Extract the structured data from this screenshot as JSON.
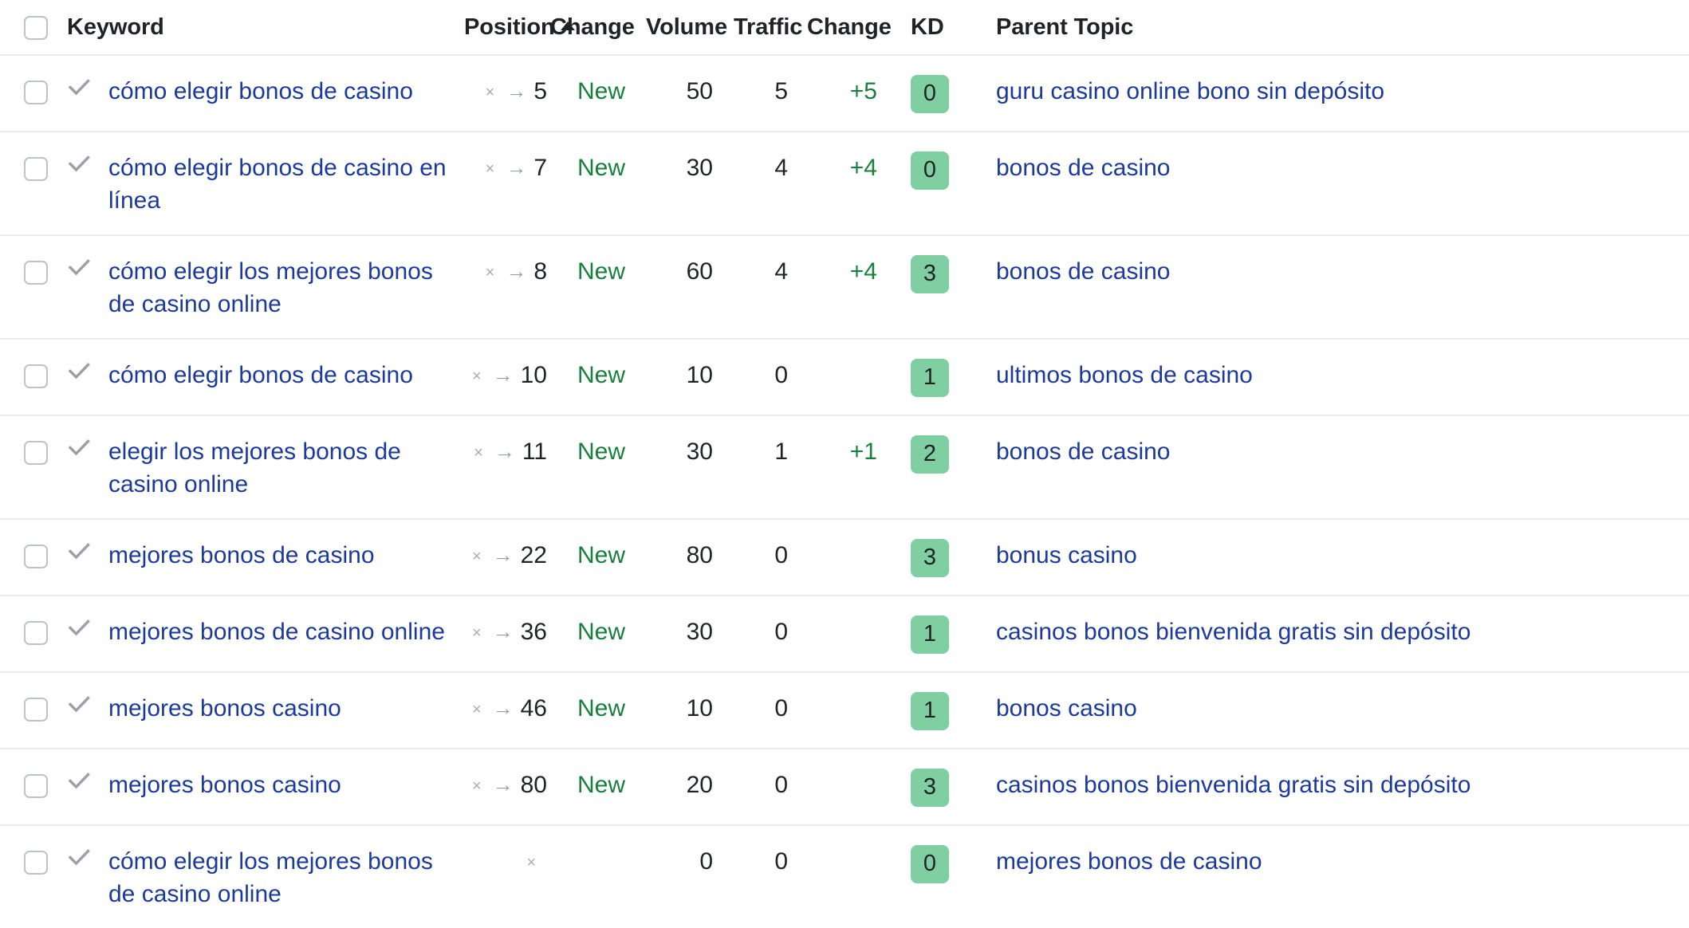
{
  "table": {
    "columns": [
      {
        "key": "checkbox",
        "label": ""
      },
      {
        "key": "keyword",
        "label": "Keyword"
      },
      {
        "key": "position",
        "label": "Position",
        "sorted": "asc"
      },
      {
        "key": "position_change",
        "label": "Change"
      },
      {
        "key": "volume",
        "label": "Volume"
      },
      {
        "key": "traffic",
        "label": "Traffic"
      },
      {
        "key": "traffic_change",
        "label": "Change"
      },
      {
        "key": "kd",
        "label": "KD"
      },
      {
        "key": "parent_topic",
        "label": "Parent Topic"
      }
    ],
    "icons": {
      "select_all": "checkbox-unchecked",
      "row_select": "checkbox-unchecked",
      "row_status": "check-icon",
      "position_remove": "close-icon",
      "position_trend": "arrow-right-icon",
      "sort": "caret-up-icon"
    },
    "colors": {
      "link": "#1b3a9c",
      "positive": "#16803c",
      "kd_badge_bg": "#7fcfa2",
      "muted": "#a9adb5",
      "row_divider": "#e9ebef"
    },
    "rows": [
      {
        "keyword": "cómo elegir bonos de casino",
        "x": "×",
        "arrow": "→",
        "position": "5",
        "position_change": "New",
        "volume": "50",
        "traffic": "5",
        "traffic_change": "+5",
        "kd": "0",
        "parent_topic": "guru casino online bono sin depósito"
      },
      {
        "keyword": "cómo elegir bonos de casino en línea",
        "x": "×",
        "arrow": "→",
        "position": "7",
        "position_change": "New",
        "volume": "30",
        "traffic": "4",
        "traffic_change": "+4",
        "kd": "0",
        "parent_topic": "bonos de casino"
      },
      {
        "keyword": "cómo elegir los mejores bonos de casino online",
        "x": "×",
        "arrow": "→",
        "position": "8",
        "position_change": "New",
        "volume": "60",
        "traffic": "4",
        "traffic_change": "+4",
        "kd": "3",
        "parent_topic": "bonos de casino"
      },
      {
        "keyword": "cómo elegir bonos de casino",
        "x": "×",
        "arrow": "→",
        "position": "10",
        "position_change": "New",
        "volume": "10",
        "traffic": "0",
        "traffic_change": "",
        "kd": "1",
        "parent_topic": "ultimos bonos de casino"
      },
      {
        "keyword": "elegir los mejores bonos de casino online",
        "x": "×",
        "arrow": "→",
        "position": "11",
        "position_change": "New",
        "volume": "30",
        "traffic": "1",
        "traffic_change": "+1",
        "kd": "2",
        "parent_topic": "bonos de casino"
      },
      {
        "keyword": "mejores bonos de casino",
        "x": "×",
        "arrow": "→",
        "position": "22",
        "position_change": "New",
        "volume": "80",
        "traffic": "0",
        "traffic_change": "",
        "kd": "3",
        "parent_topic": "bonus casino"
      },
      {
        "keyword": "mejores bonos de casino online",
        "x": "×",
        "arrow": "→",
        "position": "36",
        "position_change": "New",
        "volume": "30",
        "traffic": "0",
        "traffic_change": "",
        "kd": "1",
        "parent_topic": "casinos bonos bienvenida gratis sin depósito"
      },
      {
        "keyword": "mejores bonos casino",
        "x": "×",
        "arrow": "→",
        "position": "46",
        "position_change": "New",
        "volume": "10",
        "traffic": "0",
        "traffic_change": "",
        "kd": "1",
        "parent_topic": "bonos casino"
      },
      {
        "keyword": "mejores bonos casino",
        "x": "×",
        "arrow": "→",
        "position": "80",
        "position_change": "New",
        "volume": "20",
        "traffic": "0",
        "traffic_change": "",
        "kd": "3",
        "parent_topic": "casinos bonos bienvenida gratis sin depósito"
      },
      {
        "keyword": "cómo elegir los mejores bonos de casino online",
        "x": "×",
        "arrow": "",
        "position": "",
        "position_change": "",
        "volume": "0",
        "traffic": "0",
        "traffic_change": "",
        "kd": "0",
        "parent_topic": "mejores bonos de casino"
      }
    ]
  }
}
